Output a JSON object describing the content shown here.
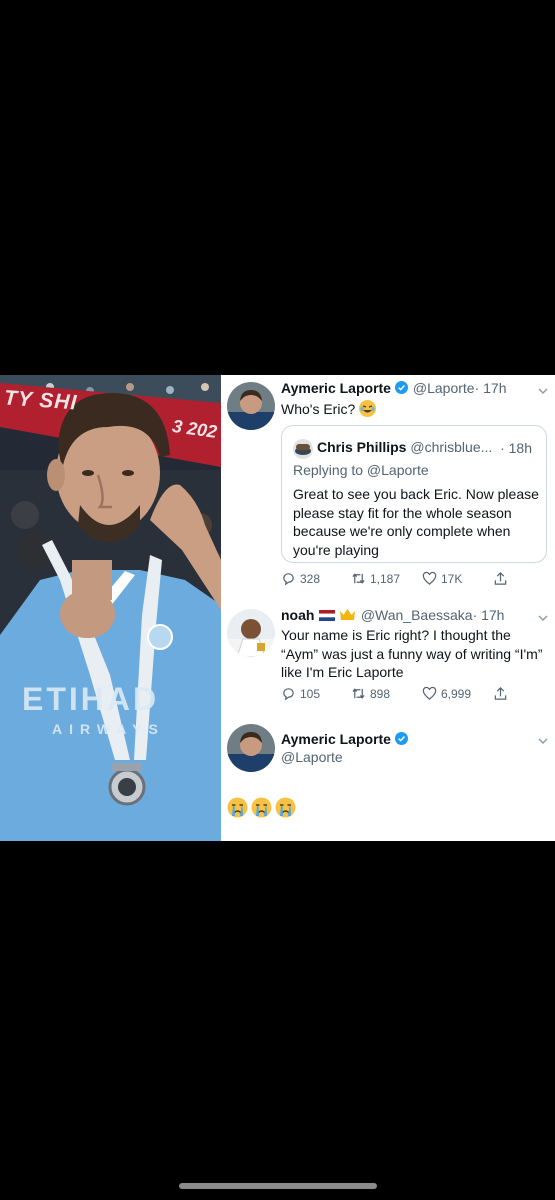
{
  "photo": {
    "banner_left": "TY SHI",
    "banner_right": "3 202",
    "shirt_sponsor": "ETIHAD",
    "shirt_sponsor_sub": "AIRWAYS"
  },
  "tweets": [
    {
      "name": "Aymeric Laporte",
      "handle": "@Laporte",
      "time": "· 17h",
      "text": "Who's Eric?",
      "quote": {
        "name": "Chris Phillips",
        "handle": "@chrisblue...",
        "time": "· 18h",
        "replying": "Replying to @Laporte",
        "text": "Great to see you back Eric. Now please please stay fit for the whole season because we're only complete when you're playing"
      },
      "replies": "328",
      "retweets": "1,187",
      "likes": "17K"
    },
    {
      "name": "noah",
      "handle": "@Wan_Baessaka",
      "time": "· 17h",
      "text": "Your name is Eric right? I thought the “Aym” was just a funny way of writing “I'm” like I'm Eric Laporte",
      "replies": "105",
      "retweets": "898",
      "likes": "6,999"
    },
    {
      "name": "Aymeric Laporte",
      "handle": "@Laporte"
    }
  ],
  "colors": {
    "verified": "#1d9bf0",
    "muted": "#536471",
    "shirt": "#6cabdd"
  },
  "icons": [
    "reply-icon",
    "retweet-icon",
    "like-icon",
    "share-icon",
    "chevron-down-icon",
    "verified-badge-icon"
  ]
}
